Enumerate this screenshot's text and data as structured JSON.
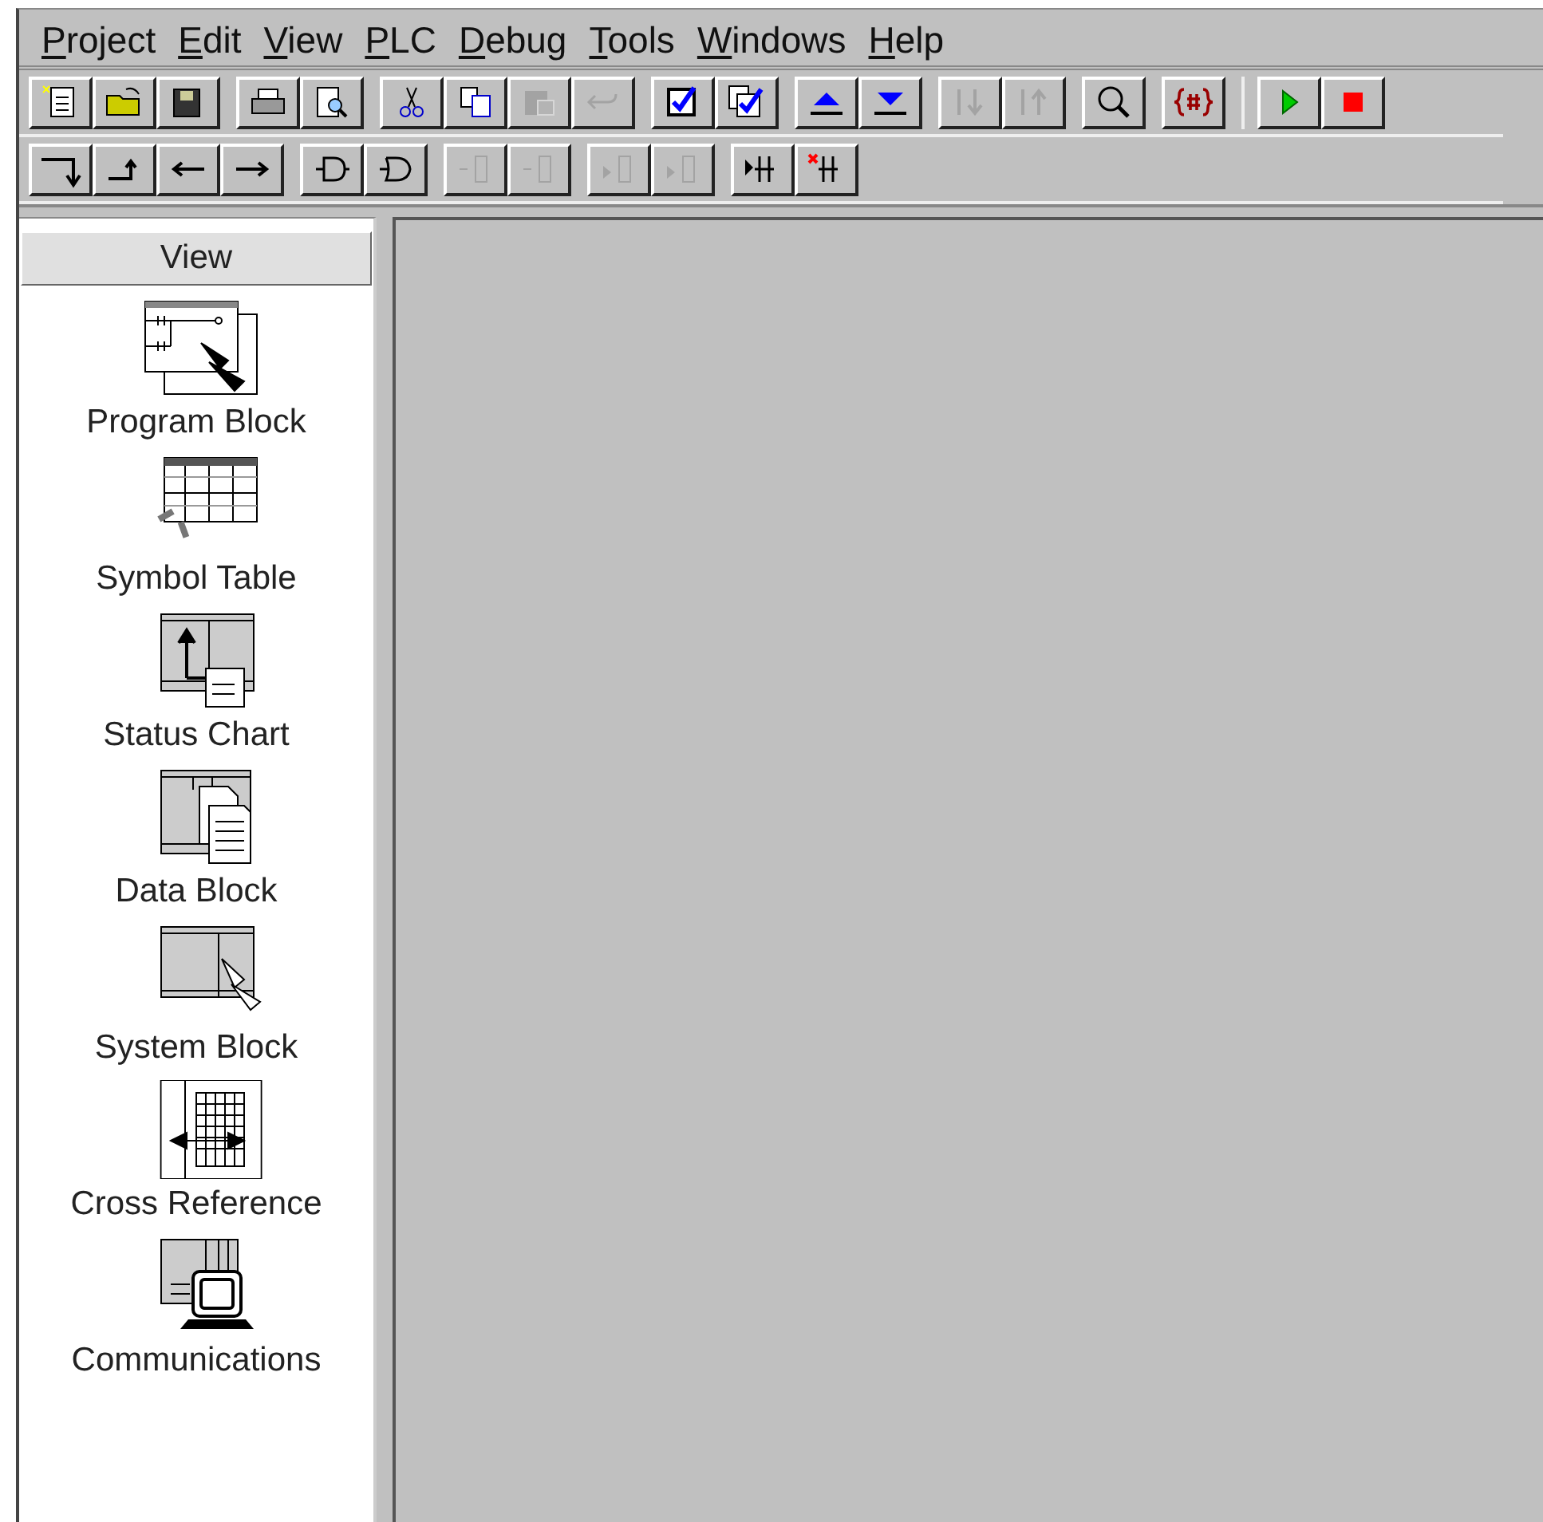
{
  "menu": [
    {
      "mnemonic": "P",
      "rest": "roject"
    },
    {
      "mnemonic": "E",
      "rest": "dit"
    },
    {
      "mnemonic": "V",
      "rest": "iew"
    },
    {
      "mnemonic": "P",
      "rest": "LC"
    },
    {
      "mnemonic": "D",
      "rest": "ebug"
    },
    {
      "mnemonic": "T",
      "rest": "ools"
    },
    {
      "mnemonic": "W",
      "rest": "indows"
    },
    {
      "mnemonic": "H",
      "rest": "elp"
    }
  ],
  "toolbars": [
    {
      "groups": [
        [
          {
            "kind": "new",
            "disabled": false
          },
          {
            "kind": "open",
            "disabled": false
          },
          {
            "kind": "save",
            "disabled": false
          }
        ],
        [
          {
            "kind": "print",
            "disabled": false
          },
          {
            "kind": "preview",
            "disabled": false
          }
        ],
        [
          {
            "kind": "cut",
            "disabled": false
          },
          {
            "kind": "copy",
            "disabled": false
          },
          {
            "kind": "paste",
            "disabled": true
          },
          {
            "kind": "undo",
            "disabled": true
          }
        ],
        [
          {
            "kind": "check",
            "disabled": false
          },
          {
            "kind": "checkall",
            "disabled": false
          }
        ],
        [
          {
            "kind": "up",
            "disabled": false
          },
          {
            "kind": "down",
            "disabled": false
          }
        ],
        [
          {
            "kind": "sortdown",
            "disabled": true
          },
          {
            "kind": "sortup",
            "disabled": true
          }
        ],
        [
          {
            "kind": "find",
            "disabled": false
          }
        ],
        [
          {
            "kind": "symbol",
            "disabled": false
          }
        ],
        [
          {
            "kind": "run",
            "disabled": false
          },
          {
            "kind": "stop",
            "disabled": false
          }
        ]
      ]
    },
    {
      "groups": [
        [
          {
            "kind": "linedown",
            "disabled": false
          },
          {
            "kind": "lineup",
            "disabled": false
          },
          {
            "kind": "left",
            "disabled": false
          },
          {
            "kind": "right",
            "disabled": false
          }
        ],
        [
          {
            "kind": "gate",
            "disabled": false
          },
          {
            "kind": "orgate",
            "disabled": false
          }
        ],
        [
          {
            "kind": "coil",
            "disabled": true
          },
          {
            "kind": "coil2",
            "disabled": true
          }
        ],
        [
          {
            "kind": "box",
            "disabled": true
          },
          {
            "kind": "box2",
            "disabled": true
          }
        ],
        [
          {
            "kind": "contact",
            "disabled": false
          },
          {
            "kind": "xcontact",
            "disabled": false
          }
        ]
      ]
    }
  ],
  "sidebar": {
    "title": "View",
    "items": [
      {
        "kind": "program",
        "label": "Program Block"
      },
      {
        "kind": "symbols",
        "label": "Symbol Table"
      },
      {
        "kind": "status",
        "label": "Status Chart"
      },
      {
        "kind": "data",
        "label": "Data Block"
      },
      {
        "kind": "system",
        "label": "System Block"
      },
      {
        "kind": "xref",
        "label": "Cross Reference"
      },
      {
        "kind": "comm",
        "label": "Communications"
      }
    ]
  }
}
